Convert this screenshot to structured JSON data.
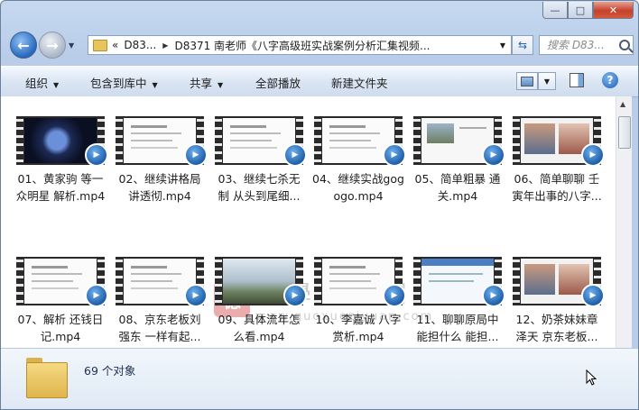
{
  "window": {
    "caption": {
      "minimize": "—",
      "maximize": "□",
      "close": "✕"
    }
  },
  "address_bar": {
    "overflow": "«",
    "segments": [
      "D83...",
      "D8371 南老师《八字高级班实战案例分析汇集视频..."
    ]
  },
  "search": {
    "placeholder": "搜索 D83..."
  },
  "toolbar": {
    "organize": "组织",
    "include_library": "包含到库中",
    "share": "共享",
    "play_all": "全部播放",
    "new_folder": "新建文件夹"
  },
  "files": [
    {
      "name": "01、黄家驹 等一众明星 解析.mp4",
      "theme": "dark"
    },
    {
      "name": "02、继续讲格局讲透彻.mp4",
      "theme": "doc"
    },
    {
      "name": "03、继续七杀无制 从头到尾细...",
      "theme": "doc"
    },
    {
      "name": "04、继续实战gogogo.mp4",
      "theme": "doc"
    },
    {
      "name": "05、简单粗暴 通关.mp4",
      "theme": "mixed"
    },
    {
      "name": "06、简单聊聊 壬寅年出事的八字...",
      "theme": "photo"
    },
    {
      "name": "07、解析 还钱日记.mp4",
      "theme": "doc"
    },
    {
      "name": "08、京东老板刘强东 一样有起...",
      "theme": "doc"
    },
    {
      "name": "09、具体流年怎么看.mp4",
      "theme": "landscape"
    },
    {
      "name": "10、李嘉诚 八字赏析.mp4",
      "theme": "doc"
    },
    {
      "name": "11、聊聊原局中能担什么 能担...",
      "theme": "blue"
    },
    {
      "name": "12、奶茶妹妹章泽天 京东老板...",
      "theme": "photo"
    }
  ],
  "watermark": {
    "seal": "德",
    "title": "國學資源網",
    "url": "www.guoxueziyuan.com"
  },
  "details": {
    "count": "69 个对象"
  },
  "colors": {
    "badge": "#1e5fa8",
    "folder": "#e8c45e"
  }
}
